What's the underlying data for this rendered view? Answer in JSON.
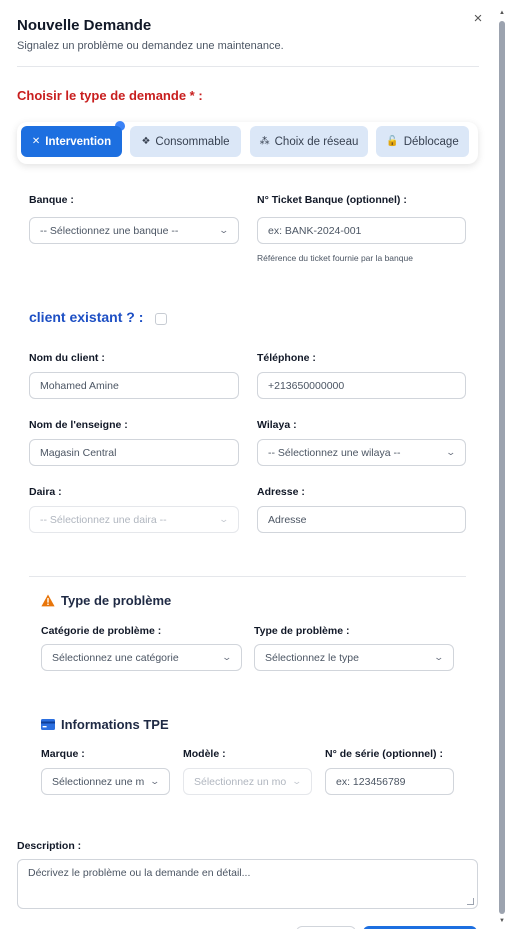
{
  "dialog": {
    "title": "Nouvelle Demande",
    "subtitle": "Signalez un problème ou demandez une maintenance.",
    "close_label": "×"
  },
  "type_section": {
    "label": "Choisir le type de demande * :",
    "options": [
      {
        "label": "Intervention",
        "icon": "tools-icon",
        "glyph": "✕",
        "active": true
      },
      {
        "label": "Consommable",
        "icon": "boxes-icon",
        "glyph": "❖",
        "active": false
      },
      {
        "label": "Choix de réseau",
        "icon": "network-icon",
        "glyph": "⁂",
        "active": false
      },
      {
        "label": "Déblocage",
        "icon": "unlock-icon",
        "glyph": "🔓",
        "active": false
      }
    ]
  },
  "bank": {
    "label": "Banque :",
    "placeholder": "-- Sélectionnez une banque --"
  },
  "ticket": {
    "label": "N° Ticket Banque (optionnel) :",
    "placeholder": "ex: BANK-2024-001",
    "hint": "Référence du ticket fournie par la banque"
  },
  "client": {
    "question": "client existant ? :",
    "checked": false
  },
  "client_name": {
    "label": "Nom du client :",
    "placeholder": "Mohamed Amine"
  },
  "phone": {
    "label": "Téléphone :",
    "placeholder": "+213650000000"
  },
  "brand_name": {
    "label": "Nom de l'enseigne :",
    "placeholder": "Magasin Central"
  },
  "wilaya": {
    "label": "Wilaya :",
    "placeholder": "-- Sélectionnez une wilaya --"
  },
  "daira": {
    "label": "Daira :",
    "placeholder": "-- Sélectionnez une daira --"
  },
  "address": {
    "label": "Adresse :",
    "placeholder": "Adresse"
  },
  "problem": {
    "heading": "Type de problème",
    "category_label": "Catégorie de problème :",
    "category_placeholder": "Sélectionnez une catégorie",
    "type_label": "Type de problème :",
    "type_placeholder": "Sélectionnez le type"
  },
  "tpe": {
    "heading": "Informations TPE",
    "brand_label": "Marque :",
    "brand_placeholder": "Sélectionnez une m",
    "model_label": "Modèle :",
    "model_placeholder": "Sélectionnez un mo",
    "serial_label": "N° de série (optionnel) :",
    "serial_placeholder": "ex: 123456789"
  },
  "description": {
    "label": "Description :",
    "placeholder": "Décrivez le problème ou la demande en détail..."
  },
  "colors": {
    "accent": "#1d6fe0",
    "required_red": "#c81e1e",
    "client_blue": "#1d4fc4",
    "warning_orange": "#e8750a"
  }
}
